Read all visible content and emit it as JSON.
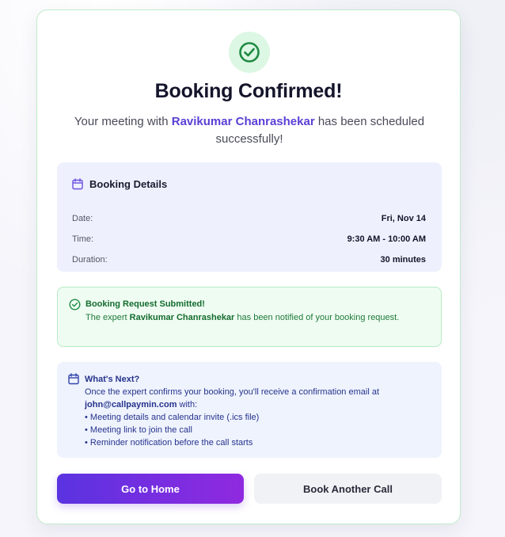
{
  "header": {
    "title": "Booking Confirmed!",
    "subtitle_prefix": "Your meeting with",
    "expert_name": "Ravikumar Chanrashekar",
    "subtitle_suffix": "has been scheduled successfully!"
  },
  "details": {
    "heading": "Booking Details",
    "rows": [
      {
        "label": "Date:",
        "value": "Fri, Nov 14"
      },
      {
        "label": "Time:",
        "value": "9:30 AM - 10:00 AM"
      },
      {
        "label": "Duration:",
        "value": "30 minutes"
      }
    ]
  },
  "notice": {
    "title": "Booking Request Submitted!",
    "text_prefix": "The expert",
    "expert_name": "Ravikumar Chanrashekar",
    "text_suffix": "has been notified of your booking request."
  },
  "next": {
    "title": "What's Next?",
    "intro": "Once the expert confirms your booking, you'll receive a confirmation email at",
    "email": "john@callpaymin.com",
    "intro_suffix": "with:",
    "bullets": [
      "• Meeting details and calendar invite (.ics file)",
      "• Meeting link to join the call",
      "• Reminder notification before the call starts"
    ]
  },
  "actions": {
    "home_label": "Go to Home",
    "another_label": "Book Another Call"
  },
  "colors": {
    "accent": "#5b3fd6",
    "success": "#146c2e",
    "info": "#27338c"
  }
}
